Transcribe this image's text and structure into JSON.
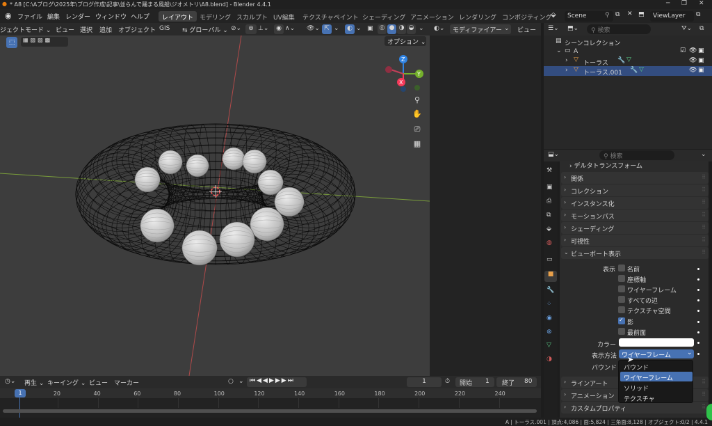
{
  "titlebar": {
    "title": "* A8 [C:\\Aブログ\\2025年\\ブログ作成\\記事\\並らんで踊まる風船\\ジオメトリ\\A8.blend] - Blender 4.4.1"
  },
  "menu": {
    "items": [
      "ファイル",
      "編集",
      "レンダー",
      "ウィンドウ",
      "ヘルプ"
    ]
  },
  "workspaces": {
    "tabs": [
      "レイアウト",
      "モデリング",
      "スカルプト",
      "UV編集",
      "テクスチャペイント",
      "シェーディング",
      "アニメーション",
      "レンダリング",
      "コンポジティング"
    ],
    "active_index": 0
  },
  "scene": {
    "name": "Scene",
    "view_layer": "ViewLayer"
  },
  "viewport_header": {
    "mode": "ジェクトモード",
    "view": "ビュー",
    "select": "選択",
    "add": "追加",
    "object": "オブジェクト",
    "gis": "GIS",
    "orientation": "グローバル",
    "options": "オプション"
  },
  "right_strip": {
    "editor": "モディファイアー",
    "view": "ビュー"
  },
  "gizmo": {
    "x": "X",
    "y": "Y",
    "z": "Z"
  },
  "outliner": {
    "search_placeholder": "検索",
    "root": "シーンコレクション",
    "collection": "A",
    "objects": [
      "トーラス",
      "トーラス.001"
    ]
  },
  "properties": {
    "search_placeholder": "検索",
    "top_item": "デルタトランスフォーム",
    "sections_top": [
      "関係",
      "コレクション",
      "インスタンス化",
      "モーションパス",
      "シェーディング",
      "可視性"
    ],
    "viewport_display": {
      "title": "ビューポート表示",
      "show_label": "表示",
      "options": [
        {
          "label": "名前",
          "checked": false
        },
        {
          "label": "座標軸",
          "checked": false
        },
        {
          "label": "ワイヤーフレーム",
          "checked": false
        },
        {
          "label": "すべての辺",
          "checked": false
        },
        {
          "label": "テクスチャ空間",
          "checked": false
        },
        {
          "label": "影",
          "checked": true
        },
        {
          "label": "最前面",
          "checked": false
        }
      ],
      "color_label": "カラー",
      "color_value": "#ffffff",
      "display_as_label": "表示方法",
      "display_as_value": "ワイヤーフレーム",
      "bounds_label": "バウンド"
    },
    "sections_bottom": [
      "ラインアート",
      "アニメーション",
      "カスタムプロパティ"
    ]
  },
  "dropdown": {
    "options": [
      "バウンド",
      "ワイヤーフレーム",
      "ソリッド",
      "テクスチャ"
    ],
    "selected_index": 1
  },
  "timeline": {
    "play": "再生",
    "keying": "キーイング",
    "view": "ビュー",
    "marker": "マーカー",
    "current_frame": "1",
    "start_label": "開始",
    "start": "1",
    "end_label": "終了",
    "end": "80",
    "ticks": [
      "1",
      "20",
      "40",
      "60",
      "80",
      "100",
      "120",
      "140",
      "160",
      "180",
      "200",
      "220",
      "240"
    ]
  },
  "statusbar": {
    "text": "A | トーラス.001 | 頂点:4,086 | 面:5,824 | 三角面:8,128 | オブジェクト:0/2 | 4.4.1"
  },
  "colors": {
    "accent": "#4772b3",
    "axis_x": "#f5395a",
    "axis_y": "#75b02c",
    "axis_z": "#2f83e3"
  }
}
